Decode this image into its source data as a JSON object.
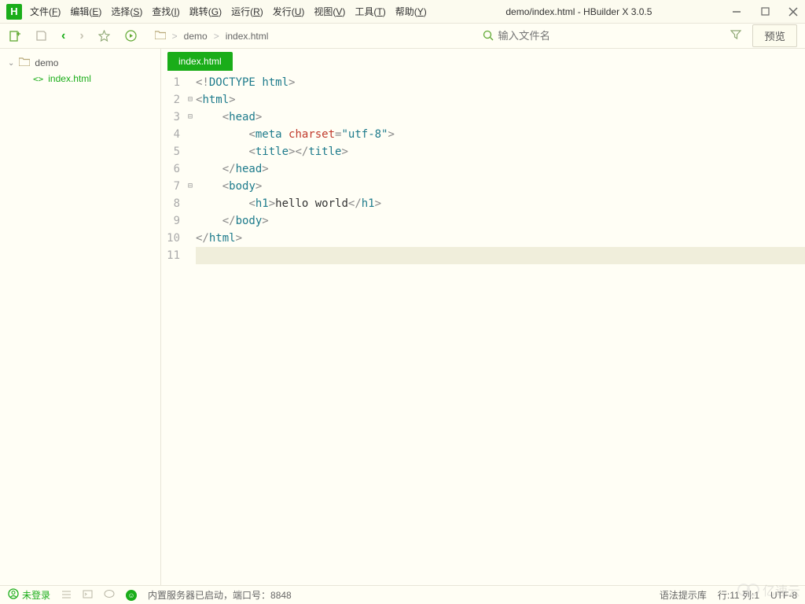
{
  "app": {
    "title": "demo/index.html - HBuilder X 3.0.5",
    "logo_letter": "H"
  },
  "menu": [
    {
      "label": "文件(F)"
    },
    {
      "label": "编辑(E)"
    },
    {
      "label": "选择(S)"
    },
    {
      "label": "查找(I)"
    },
    {
      "label": "跳转(G)"
    },
    {
      "label": "运行(R)"
    },
    {
      "label": "发行(U)"
    },
    {
      "label": "视图(V)"
    },
    {
      "label": "工具(T)"
    },
    {
      "label": "帮助(Y)"
    }
  ],
  "toolbar": {
    "breadcrumb": [
      {
        "type": "folder-icon"
      },
      {
        "type": "sep",
        "label": ">"
      },
      {
        "type": "text",
        "label": "demo"
      },
      {
        "type": "sep",
        "label": ">"
      },
      {
        "type": "text",
        "label": "index.html"
      }
    ],
    "search_placeholder": "输入文件名",
    "preview_label": "预览"
  },
  "sidebar": {
    "root": {
      "label": "demo",
      "expanded": true
    },
    "children": [
      {
        "label": "index.html",
        "active": true
      }
    ]
  },
  "editor": {
    "active_tab": "index.html",
    "lines": [
      {
        "n": 1,
        "fold": "",
        "html": "<span class='punct'>&lt;!</span><span class='tag'>DOCTYPE</span> <span class='tag'>html</span><span class='punct'>&gt;</span>"
      },
      {
        "n": 2,
        "fold": "⊟",
        "html": "<span class='punct'>&lt;</span><span class='tag'>html</span><span class='punct'>&gt;</span>"
      },
      {
        "n": 3,
        "fold": "⊟",
        "html": "    <span class='punct'>&lt;</span><span class='tag'>head</span><span class='punct'>&gt;</span>"
      },
      {
        "n": 4,
        "fold": "",
        "html": "        <span class='punct'>&lt;</span><span class='tag'>meta</span> <span class='attr'>charset</span><span class='punct'>=</span><span class='val'>\"utf-8\"</span><span class='punct'>&gt;</span>"
      },
      {
        "n": 5,
        "fold": "",
        "html": "        <span class='punct'>&lt;</span><span class='tag'>title</span><span class='punct'>&gt;&lt;/</span><span class='tag'>title</span><span class='punct'>&gt;</span>"
      },
      {
        "n": 6,
        "fold": "",
        "html": "    <span class='punct'>&lt;/</span><span class='tag'>head</span><span class='punct'>&gt;</span>"
      },
      {
        "n": 7,
        "fold": "⊟",
        "html": "    <span class='punct'>&lt;</span><span class='tag'>body</span><span class='punct'>&gt;</span>"
      },
      {
        "n": 8,
        "fold": "",
        "html": "        <span class='punct'>&lt;</span><span class='tag'>h1</span><span class='punct'>&gt;</span><span class='txt'>hello world</span><span class='punct'>&lt;/</span><span class='tag'>h1</span><span class='punct'>&gt;</span>"
      },
      {
        "n": 9,
        "fold": "",
        "html": "    <span class='punct'>&lt;/</span><span class='tag'>body</span><span class='punct'>&gt;</span>"
      },
      {
        "n": 10,
        "fold": "",
        "html": "<span class='punct'>&lt;/</span><span class='tag'>html</span><span class='punct'>&gt;</span>"
      },
      {
        "n": 11,
        "fold": "",
        "html": "",
        "hl": true
      }
    ]
  },
  "statusbar": {
    "login": "未登录",
    "server_msg": "内置服务器已启动，端口号：8848",
    "syntax": "语法提示库",
    "position": "行:11  列:1",
    "encoding": "UTF-8"
  },
  "watermark": "亿速云"
}
